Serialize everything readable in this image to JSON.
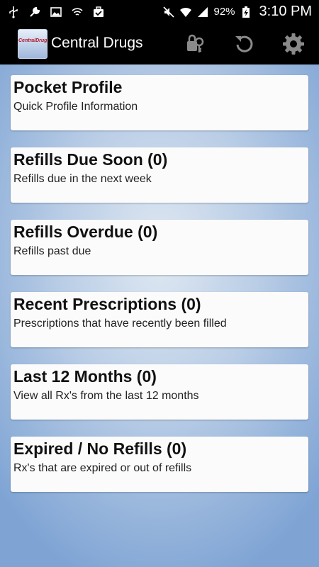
{
  "status_bar": {
    "battery": "92%",
    "time": "3:10 PM"
  },
  "action_bar": {
    "logo_text": "CentralDrugs",
    "title": "Central Drugs"
  },
  "menu": [
    {
      "title": "Pocket Profile",
      "subtitle": "Quick Profile Information"
    },
    {
      "title": "Refills Due Soon (0)",
      "subtitle": "Refills due in the next week"
    },
    {
      "title": "Refills Overdue (0)",
      "subtitle": "Refills past due"
    },
    {
      "title": "Recent Prescriptions (0)",
      "subtitle": "Prescriptions that have recently been filled"
    },
    {
      "title": "Last 12 Months (0)",
      "subtitle": "View all Rx's from the last 12 months"
    },
    {
      "title": "Expired / No Refills (0)",
      "subtitle": "Rx's that are expired or out of refills"
    }
  ]
}
